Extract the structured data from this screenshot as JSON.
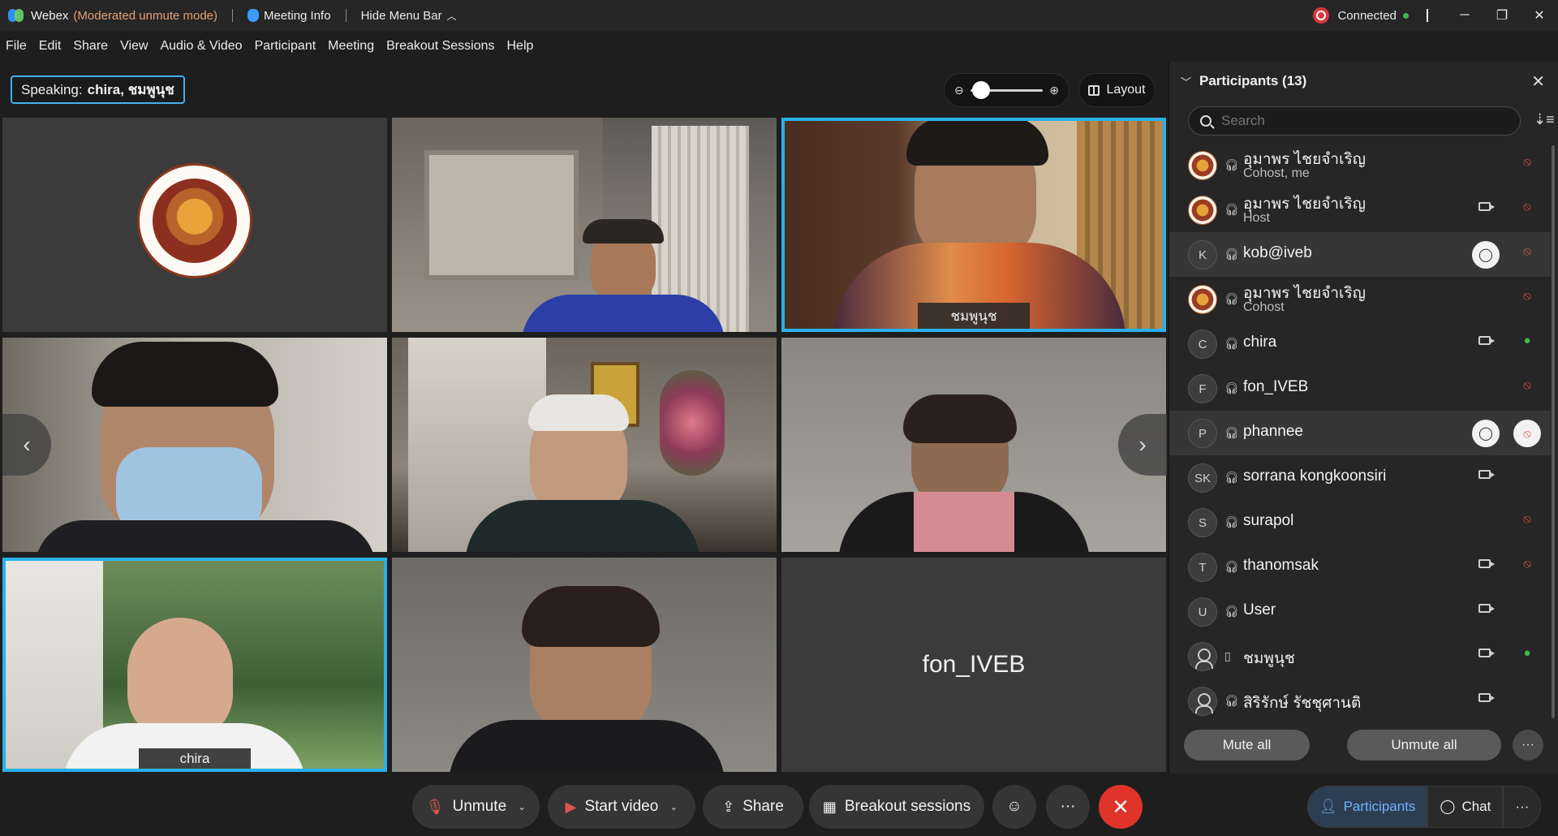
{
  "titlebar": {
    "app_name": "Webex",
    "mode": "(Moderated unmute mode)",
    "meeting_info": "Meeting Info",
    "hide_menu": "Hide Menu Bar",
    "status": "Connected"
  },
  "menu": [
    "File",
    "Edit",
    "Share",
    "View",
    "Audio & Video",
    "Participant",
    "Meeting",
    "Breakout Sessions",
    "Help"
  ],
  "stage": {
    "speaking_prefix": "Speaking:",
    "speaking_names": "chira, ชมพูนุช",
    "layout_label": "Layout",
    "tiles": [
      {
        "label": ""
      },
      {
        "label": ""
      },
      {
        "label": "ชมพูนุช"
      },
      {
        "label": ""
      },
      {
        "label": ""
      },
      {
        "label": ""
      },
      {
        "label": "chira"
      },
      {
        "label": ""
      },
      {
        "bigname": "fon_IVEB"
      }
    ]
  },
  "controls": {
    "unmute": "Unmute",
    "start_video": "Start video",
    "share": "Share",
    "breakout": "Breakout sessions"
  },
  "panel": {
    "title": "Participants (13)",
    "search_placeholder": "Search",
    "participants": [
      {
        "name": "อุมาพร ไชยจำเริญ",
        "role": "Cohost, me",
        "avatar": "seal",
        "mic": "muted"
      },
      {
        "name": "อุมาพร ไชยจำเริญ",
        "role": "Host",
        "avatar": "seal",
        "mic": "muted",
        "camera": true
      },
      {
        "name": "kob@iveb",
        "role": "",
        "avatar": "K",
        "mic": "muted",
        "chat": true
      },
      {
        "name": "อุมาพร ไชยจำเริญ",
        "role": "Cohost",
        "avatar": "seal",
        "mic": "muted"
      },
      {
        "name": "chira",
        "role": "",
        "avatar": "C",
        "mic": "active",
        "camera": true
      },
      {
        "name": "fon_IVEB",
        "role": "",
        "avatar": "F",
        "mic": "muted"
      },
      {
        "name": "phannee",
        "role": "",
        "avatar": "P",
        "mic": "muted",
        "chat": true
      },
      {
        "name": "sorrana kongkoonsiri",
        "role": "",
        "avatar": "SK",
        "camera": true
      },
      {
        "name": "surapol",
        "role": "",
        "avatar": "S",
        "mic": "muted"
      },
      {
        "name": "thanomsak",
        "role": "",
        "avatar": "T",
        "mic": "muted",
        "camera": true
      },
      {
        "name": "User",
        "role": "",
        "avatar": "U",
        "camera": true
      },
      {
        "name": "ชมพูนุช",
        "role": "",
        "avatar": "user",
        "mic": "active",
        "camera": true
      },
      {
        "name": "สิริรักษ์ รัชชุศานติ",
        "role": "",
        "avatar": "user",
        "camera": true
      }
    ],
    "mute_all": "Mute all",
    "unmute_all": "Unmute all"
  },
  "tabs": {
    "participants": "Participants",
    "chat": "Chat"
  },
  "colors": {
    "accent": "#2ab0e8",
    "mode_orange": "#e6a06d",
    "muted_red": "#e2554a",
    "active_green": "#3cbd4a",
    "end_red": "#e0342b"
  }
}
